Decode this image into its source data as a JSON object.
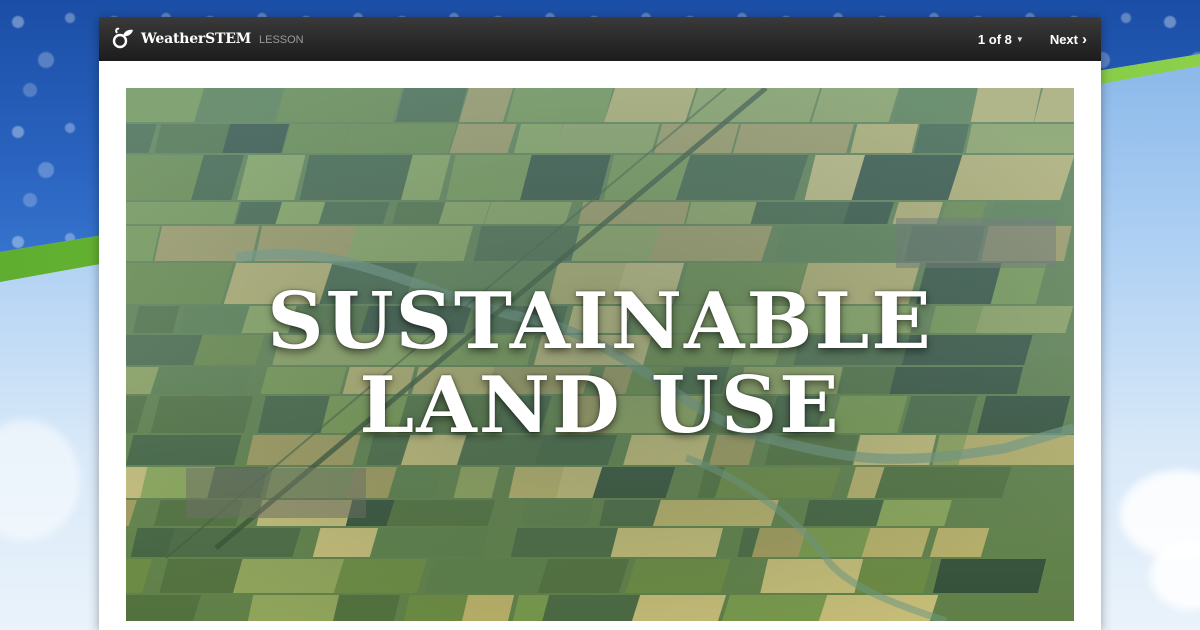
{
  "app": {
    "brand_name": "WeatherSTEM",
    "brand_tag": "LESSON",
    "logo_icon": "weatherstem-logo-icon"
  },
  "nav": {
    "pager_label": "1 of 8",
    "pager_icon": "caret-down-icon",
    "next_label": "Next",
    "next_icon": "chevron-right-icon"
  },
  "hero": {
    "title_line_1": "SUSTAINABLE",
    "title_line_2": "LAND USE",
    "image_subject": "aerial-farmland-image"
  },
  "colors": {
    "topbar": "#1c1c1c",
    "brand_accent_green": "#7cc242",
    "background_blue": "#2a64c0",
    "title_text": "#ffffff"
  }
}
